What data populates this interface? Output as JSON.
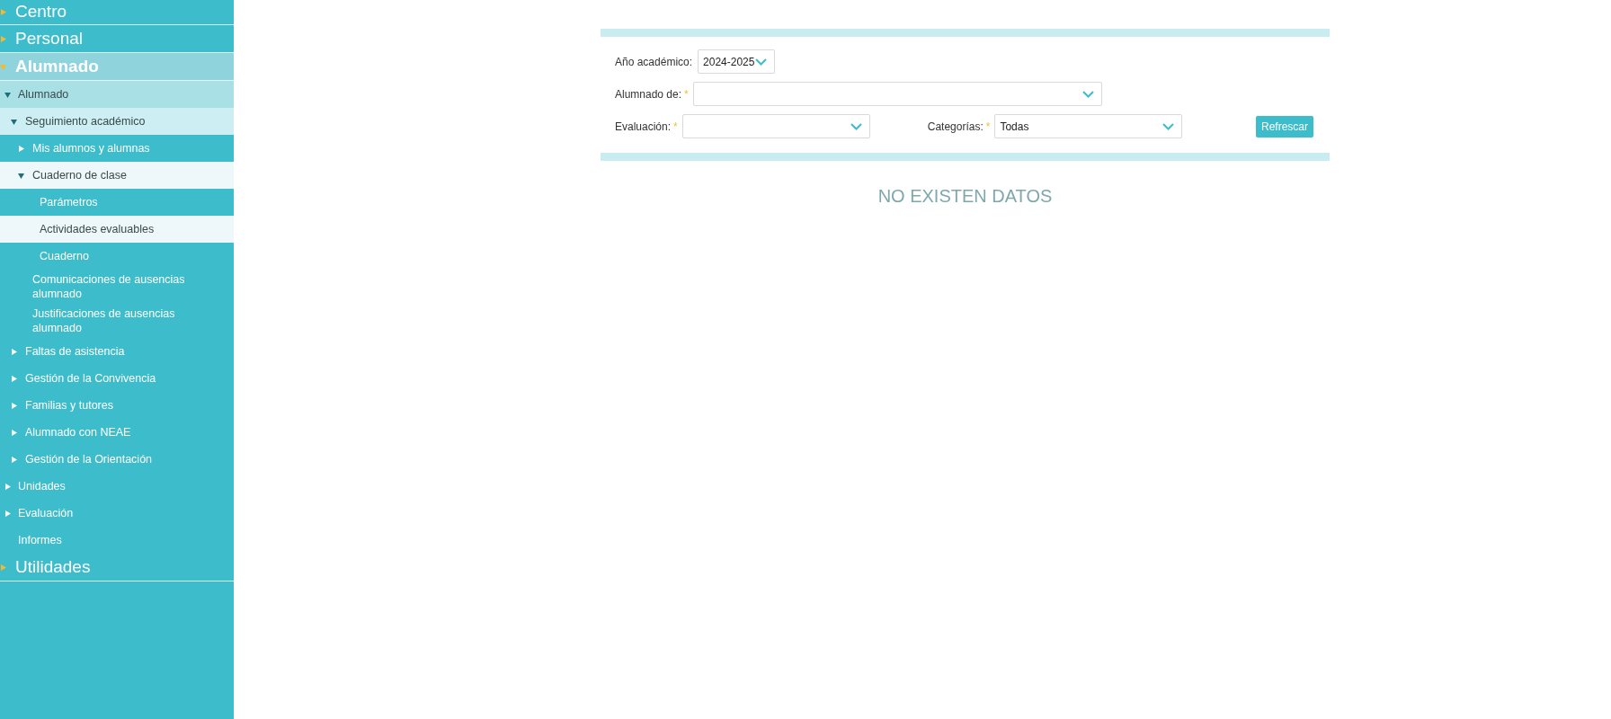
{
  "sidebar": {
    "items": [
      {
        "label": "Centro",
        "expanded": false
      },
      {
        "label": "Personal",
        "expanded": false
      },
      {
        "label": "Alumnado",
        "expanded": true,
        "children": [
          {
            "label": "Alumnado",
            "expanded": true,
            "children": [
              {
                "label": "Seguimiento académico",
                "expanded": true,
                "children": [
                  {
                    "label": "Mis alumnos y alumnas",
                    "expanded": false
                  },
                  {
                    "label": "Cuaderno de clase",
                    "expanded": true,
                    "children": [
                      {
                        "label": "Parámetros",
                        "selected": false
                      },
                      {
                        "label": "Actividades evaluables",
                        "selected": true
                      },
                      {
                        "label": "Cuaderno",
                        "selected": false
                      }
                    ]
                  },
                  {
                    "label": "Comunicaciones de ausencias alumnado",
                    "selected": false
                  },
                  {
                    "label": "Justificaciones de ausencias alumnado",
                    "selected": false
                  }
                ]
              },
              {
                "label": "Faltas de asistencia",
                "expanded": false
              },
              {
                "label": "Gestión de la Convivencia",
                "expanded": false
              },
              {
                "label": "Familias y tutores",
                "expanded": false
              },
              {
                "label": "Alumnado con NEAE",
                "expanded": false
              },
              {
                "label": "Gestión de la Orientación",
                "expanded": false
              }
            ]
          },
          {
            "label": "Unidades",
            "expanded": false
          },
          {
            "label": "Evaluación",
            "expanded": false
          },
          {
            "label": "Informes",
            "selected": false
          }
        ]
      },
      {
        "label": "Utilidades",
        "expanded": false
      }
    ]
  },
  "filters": {
    "academic_year": {
      "label": "Año académico:",
      "value": "2024-2025"
    },
    "students_of": {
      "label": "Alumnado de:",
      "required_mark": "*"
    },
    "evaluation": {
      "label": "Evaluación:",
      "required_mark": "*"
    },
    "categories": {
      "label": "Categorías:",
      "required_mark": "*",
      "value": "Todas"
    },
    "refresh_button": "Refrescar"
  },
  "empty_message": "NO EXISTEN DATOS"
}
